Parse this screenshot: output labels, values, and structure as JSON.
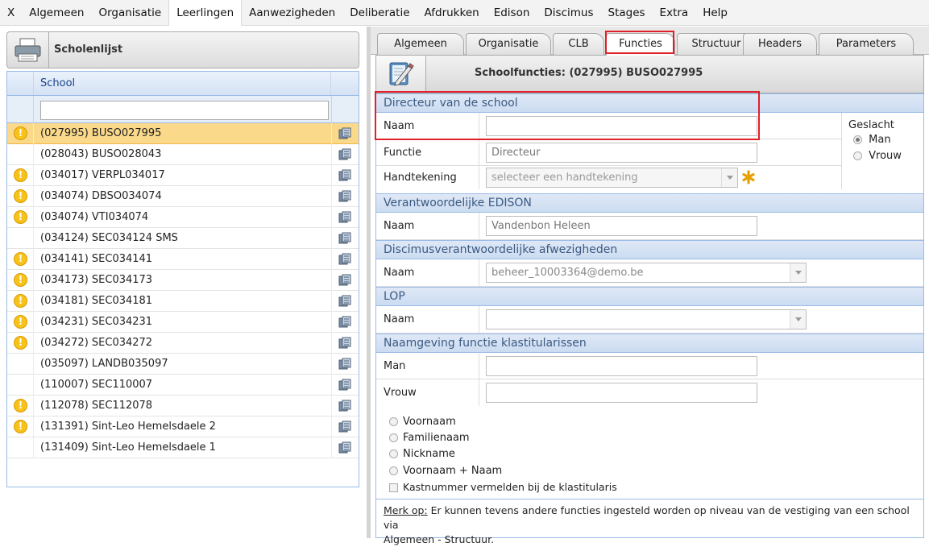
{
  "menu": [
    "X",
    "Algemeen",
    "Organisatie",
    "Leerlingen",
    "Aanwezigheden",
    "Deliberatie",
    "Afdrukken",
    "Edison",
    "Discimus",
    "Stages",
    "Extra",
    "Help"
  ],
  "menu_active": "Leerlingen",
  "left": {
    "title": "Scholenlijst",
    "column_header": "School",
    "filter_value": "",
    "rows": [
      {
        "name": "(027995) BUSO027995",
        "warning": true,
        "selected": true
      },
      {
        "name": "(028043) BUSO028043",
        "warning": false,
        "selected": false
      },
      {
        "name": "(034017) VERPL034017",
        "warning": true,
        "selected": false
      },
      {
        "name": "(034074) DBSO034074",
        "warning": true,
        "selected": false
      },
      {
        "name": "(034074) VTI034074",
        "warning": true,
        "selected": false
      },
      {
        "name": "(034124) SEC034124 SMS",
        "warning": false,
        "selected": false
      },
      {
        "name": "(034141) SEC034141",
        "warning": true,
        "selected": false
      },
      {
        "name": "(034173) SEC034173",
        "warning": true,
        "selected": false
      },
      {
        "name": "(034181) SEC034181",
        "warning": true,
        "selected": false
      },
      {
        "name": "(034231) SEC034231",
        "warning": true,
        "selected": false
      },
      {
        "name": "(034272) SEC034272",
        "warning": true,
        "selected": false
      },
      {
        "name": "(035097) LANDB035097",
        "warning": false,
        "selected": false
      },
      {
        "name": "(110007) SEC110007",
        "warning": false,
        "selected": false
      },
      {
        "name": "(112078) SEC112078",
        "warning": true,
        "selected": false
      },
      {
        "name": "(131391) Sint-Leo Hemelsdaele 2",
        "warning": true,
        "selected": false
      },
      {
        "name": "(131409) Sint-Leo Hemelsdaele 1",
        "warning": false,
        "selected": false
      }
    ],
    "warning_glyph": "!"
  },
  "tabs": [
    "Algemeen",
    "Organisatie",
    "CLB",
    "Functies",
    "Structuur",
    "Headers",
    "Parameters"
  ],
  "active_tab": "Functies",
  "right": {
    "title": "Schoolfuncties: (027995) BUSO027995",
    "sections": {
      "director": {
        "heading": "Directeur van de school",
        "name_label": "Naam",
        "name_value": "",
        "function_label": "Functie",
        "function_value": "Directeur",
        "signature_label": "Handtekening",
        "signature_placeholder": "selecteer een handtekening",
        "gender_label": "Geslacht",
        "gender_male": "Man",
        "gender_female": "Vrouw",
        "gender_selected": "Man"
      },
      "edison": {
        "heading": "Verantwoordelijke EDISON",
        "name_label": "Naam",
        "name_value": "Vandenbon Heleen"
      },
      "discimus": {
        "heading": "Discimusverantwoordelijke afwezigheden",
        "name_label": "Naam",
        "name_value": "beheer_10003364@demo.be"
      },
      "lop": {
        "heading": "LOP",
        "name_label": "Naam",
        "name_value": ""
      },
      "klastitularis": {
        "heading": "Naamgeving functie klastitularissen",
        "man_label": "Man",
        "man_value": "",
        "vrouw_label": "Vrouw",
        "vrouw_value": "",
        "options": [
          "Voornaam",
          "Familienaam",
          "Nickname",
          "Voornaam + Naam"
        ],
        "checkbox_label": "Kastnummer vermelden bij de klastitularis"
      }
    },
    "note_prefix": "Merk op:",
    "note_line1": " Er kunnen tevens andere functies ingesteld worden op niveau van de vestiging van een school via",
    "note_line2": "Algemeen - Structuur."
  },
  "colors": {
    "highlight": "#e0202a",
    "selected_row": "#fbd98a",
    "section_header": "#cbdcf1",
    "warning": "#f7c21a"
  }
}
